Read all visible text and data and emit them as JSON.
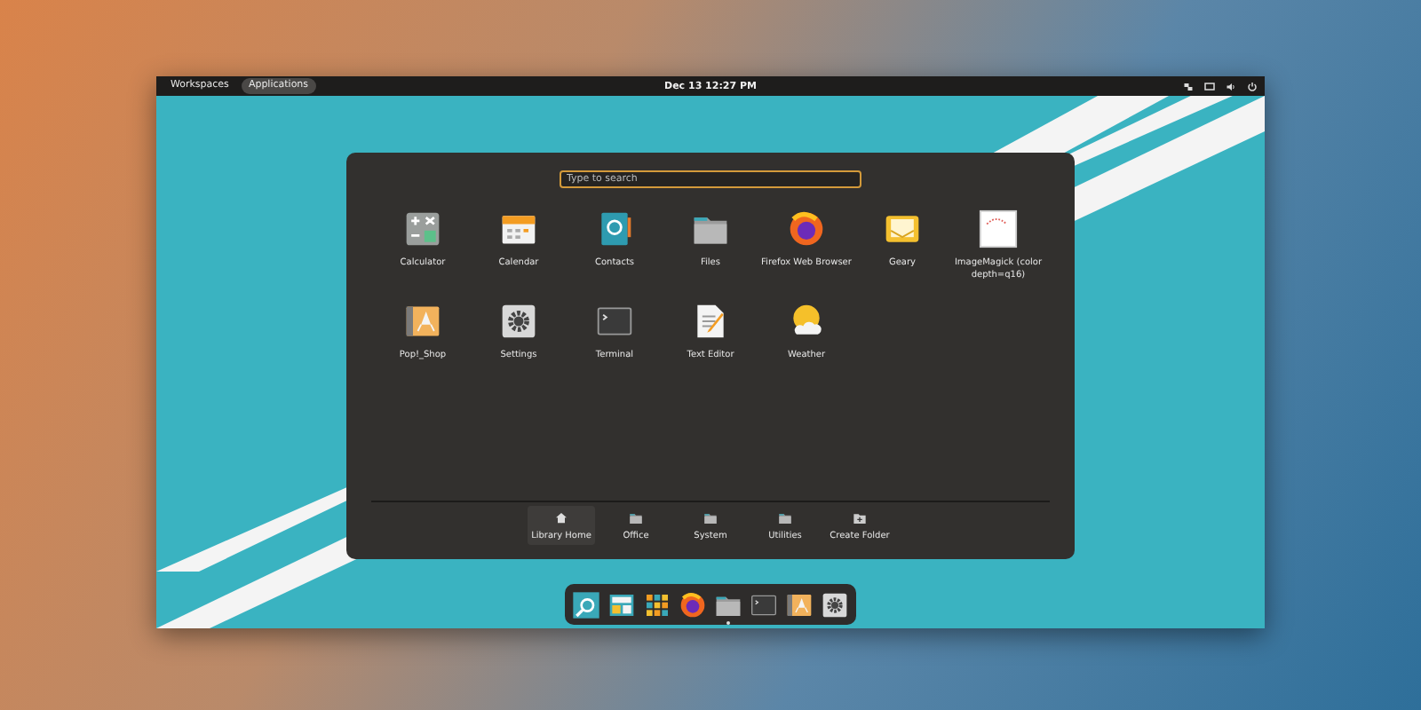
{
  "top_bar": {
    "workspaces": {
      "label": "Workspaces",
      "selected": false
    },
    "applications": {
      "label": "Applications",
      "selected": true
    },
    "clock": "Dec 13  12:27 PM",
    "indicators": [
      {
        "kind": "network"
      },
      {
        "kind": "display"
      },
      {
        "kind": "volume"
      },
      {
        "kind": "power"
      }
    ]
  },
  "launcher": {
    "search": {
      "placeholder": "Type to search"
    },
    "apps": [
      {
        "label": "Calculator",
        "kind": "calculator"
      },
      {
        "label": "Calendar",
        "kind": "calendar"
      },
      {
        "label": "Contacts",
        "kind": "contacts"
      },
      {
        "label": "Files",
        "kind": "folder"
      },
      {
        "label": "Firefox Web Browser",
        "kind": "browser"
      },
      {
        "label": "Geary",
        "kind": "mail"
      },
      {
        "label": "ImageMagick (color depth=q16)",
        "kind": "image"
      },
      {
        "label": "Pop!_Shop",
        "kind": "shop"
      },
      {
        "label": "Settings",
        "kind": "settings"
      },
      {
        "label": "Terminal",
        "kind": "terminal"
      },
      {
        "label": "Text Editor",
        "kind": "editor"
      },
      {
        "label": "Weather",
        "kind": "weather"
      }
    ],
    "folders": [
      {
        "label": "Library Home",
        "kind": "home",
        "selected": true
      },
      {
        "label": "Office",
        "kind": "folder",
        "selected": false
      },
      {
        "label": "System",
        "kind": "folder",
        "selected": false
      },
      {
        "label": "Utilities",
        "kind": "folder",
        "selected": false
      },
      {
        "label": "Create Folder",
        "kind": "add-folder",
        "selected": false
      }
    ]
  },
  "dock": [
    {
      "kind": "search",
      "running": false
    },
    {
      "kind": "workspaces",
      "running": false
    },
    {
      "kind": "grid",
      "running": false
    },
    {
      "kind": "browser",
      "running": false
    },
    {
      "kind": "folder",
      "running": true
    },
    {
      "kind": "terminal",
      "running": false
    },
    {
      "kind": "shop",
      "running": false
    },
    {
      "kind": "settings",
      "running": false
    }
  ]
}
